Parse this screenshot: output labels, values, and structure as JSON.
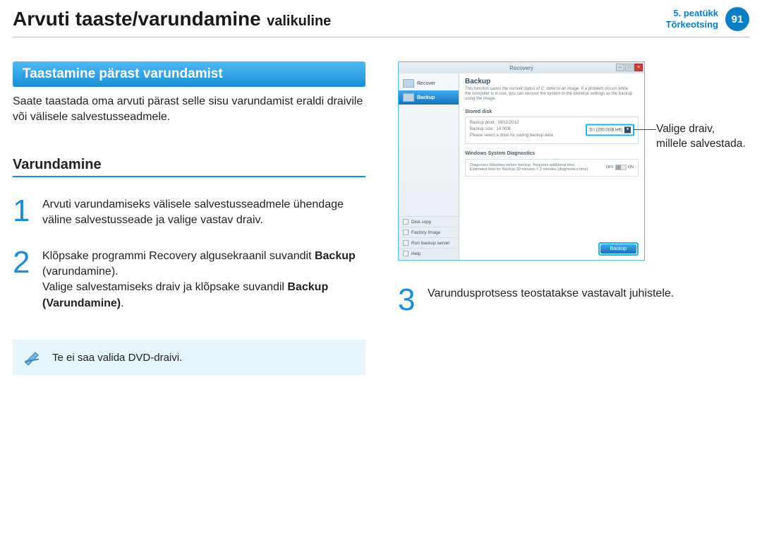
{
  "header": {
    "title_main": "Arvuti taaste/varundamine",
    "title_sub": "valikuline",
    "chapter_line1": "5. peatükk",
    "chapter_line2": "Tõrkeotsing",
    "page_number": "91"
  },
  "section_banner": "Taastamine pärast varundamist",
  "section_intro": "Saate taastada oma arvuti pärast selle sisu varundamist eraldi draivile või välisele salvestusseadmele.",
  "subheading": "Varundamine",
  "steps": {
    "s1": {
      "num": "1",
      "text": "Arvuti varundamiseks välisele salvestusseadmele ühendage väline salvestusseade ja valige vastav draiv."
    },
    "s2": {
      "num": "2",
      "line1_a": "Klõpsake programmi Recovery algusekraanil suvandit ",
      "line1_b": "Backup",
      "line1_c": " (varundamine).",
      "line2_a": "Valige salvestamiseks draiv ja klõpsake suvandil ",
      "line2_b": "Backup (Varundamine)",
      "line2_c": "."
    },
    "s3": {
      "num": "3",
      "text": "Varundusprotsess teostatakse vastavalt juhistele."
    }
  },
  "note": "Te ei saa valida DVD-draivi.",
  "callout": "Valige draiv, millele salvestada.",
  "app": {
    "title": "Recovery",
    "side_recover": "Recover",
    "side_backup": "Backup",
    "side_links": [
      "Disk copy",
      "Factory Image",
      "Run backup server",
      "Help"
    ],
    "main_title": "Backup",
    "main_desc": "This function saves the current status of C: drive to an image. If a problem occurs while the computer is in use, you can recover the system to the identical settings as the backup using the image.",
    "stored_label": "Stored disk",
    "stored_point": "Backup point : 09/11/2012",
    "stored_size": "Backup size : 14.0GB",
    "stored_hint": "Please select a drive for saving backup data.",
    "drive_value": "D:\\ (200.0GB left)",
    "diag_label": "Windows System Diagnostics",
    "diag_line1": "Diagnoses Windows before backup. Requires additional time.",
    "diag_line2": "Estimated time for Backup 30 minutes + 2 minutes (diagnostics time)",
    "toggle_off": "OFF",
    "toggle_on": "ON",
    "backup_btn": "Backup"
  }
}
